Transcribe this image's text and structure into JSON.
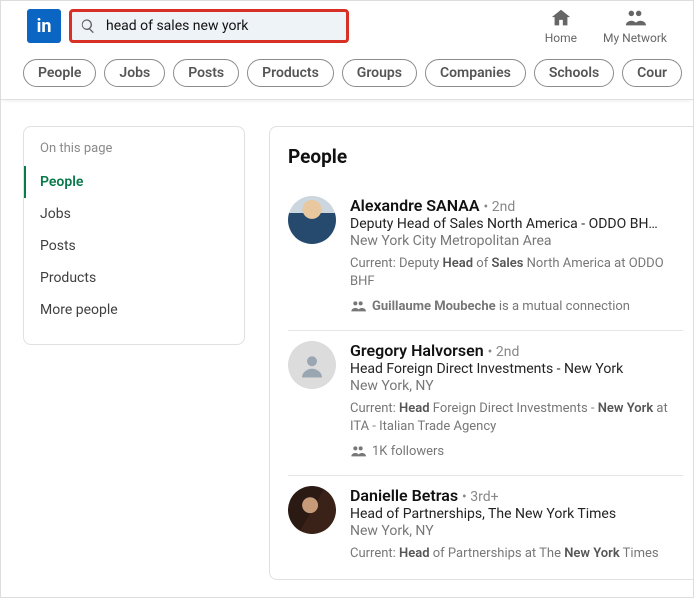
{
  "search": {
    "value": "head of sales new york"
  },
  "nav": {
    "home": "Home",
    "network": "My Network"
  },
  "filters": [
    "People",
    "Jobs",
    "Posts",
    "Products",
    "Groups",
    "Companies",
    "Schools",
    "Cour"
  ],
  "sidebar": {
    "title": "On this page",
    "items": [
      "People",
      "Jobs",
      "Posts",
      "Products",
      "More people"
    ]
  },
  "main": {
    "heading": "People",
    "results": [
      {
        "name": "Alexandre SANAA",
        "degree": "2nd",
        "headline_pre": "Deputy Head of Sales",
        "headline_post": " North America - ODDO BH…",
        "location": "New York City Metropolitan Area",
        "current_pre": "Current: Deputy ",
        "current_b1": "Head",
        "current_mid": " of ",
        "current_b2": "Sales",
        "current_post": " North America at ODDO BHF",
        "mutual_name": "Guillaume Moubeche",
        "mutual_tail": " is a mutual connection"
      },
      {
        "name": "Gregory Halvorsen",
        "degree": "2nd",
        "headline": "Head Foreign Direct Investments - New York",
        "location": "New York, NY",
        "current_pre": "Current: ",
        "current_b1": "Head",
        "current_mid": " Foreign Direct Investments - ",
        "current_b2": "New York",
        "current_post": " at ITA - Italian Trade Agency",
        "followers": "1K followers"
      },
      {
        "name": "Danielle Betras",
        "degree": "3rd+",
        "headline": "Head of Partnerships, The New York Times",
        "location": "New York, NY",
        "current_pre": "Current: ",
        "current_b1": "Head",
        "current_mid": " of Partnerships at The ",
        "current_b2": "New York",
        "current_post": " Times"
      }
    ]
  }
}
